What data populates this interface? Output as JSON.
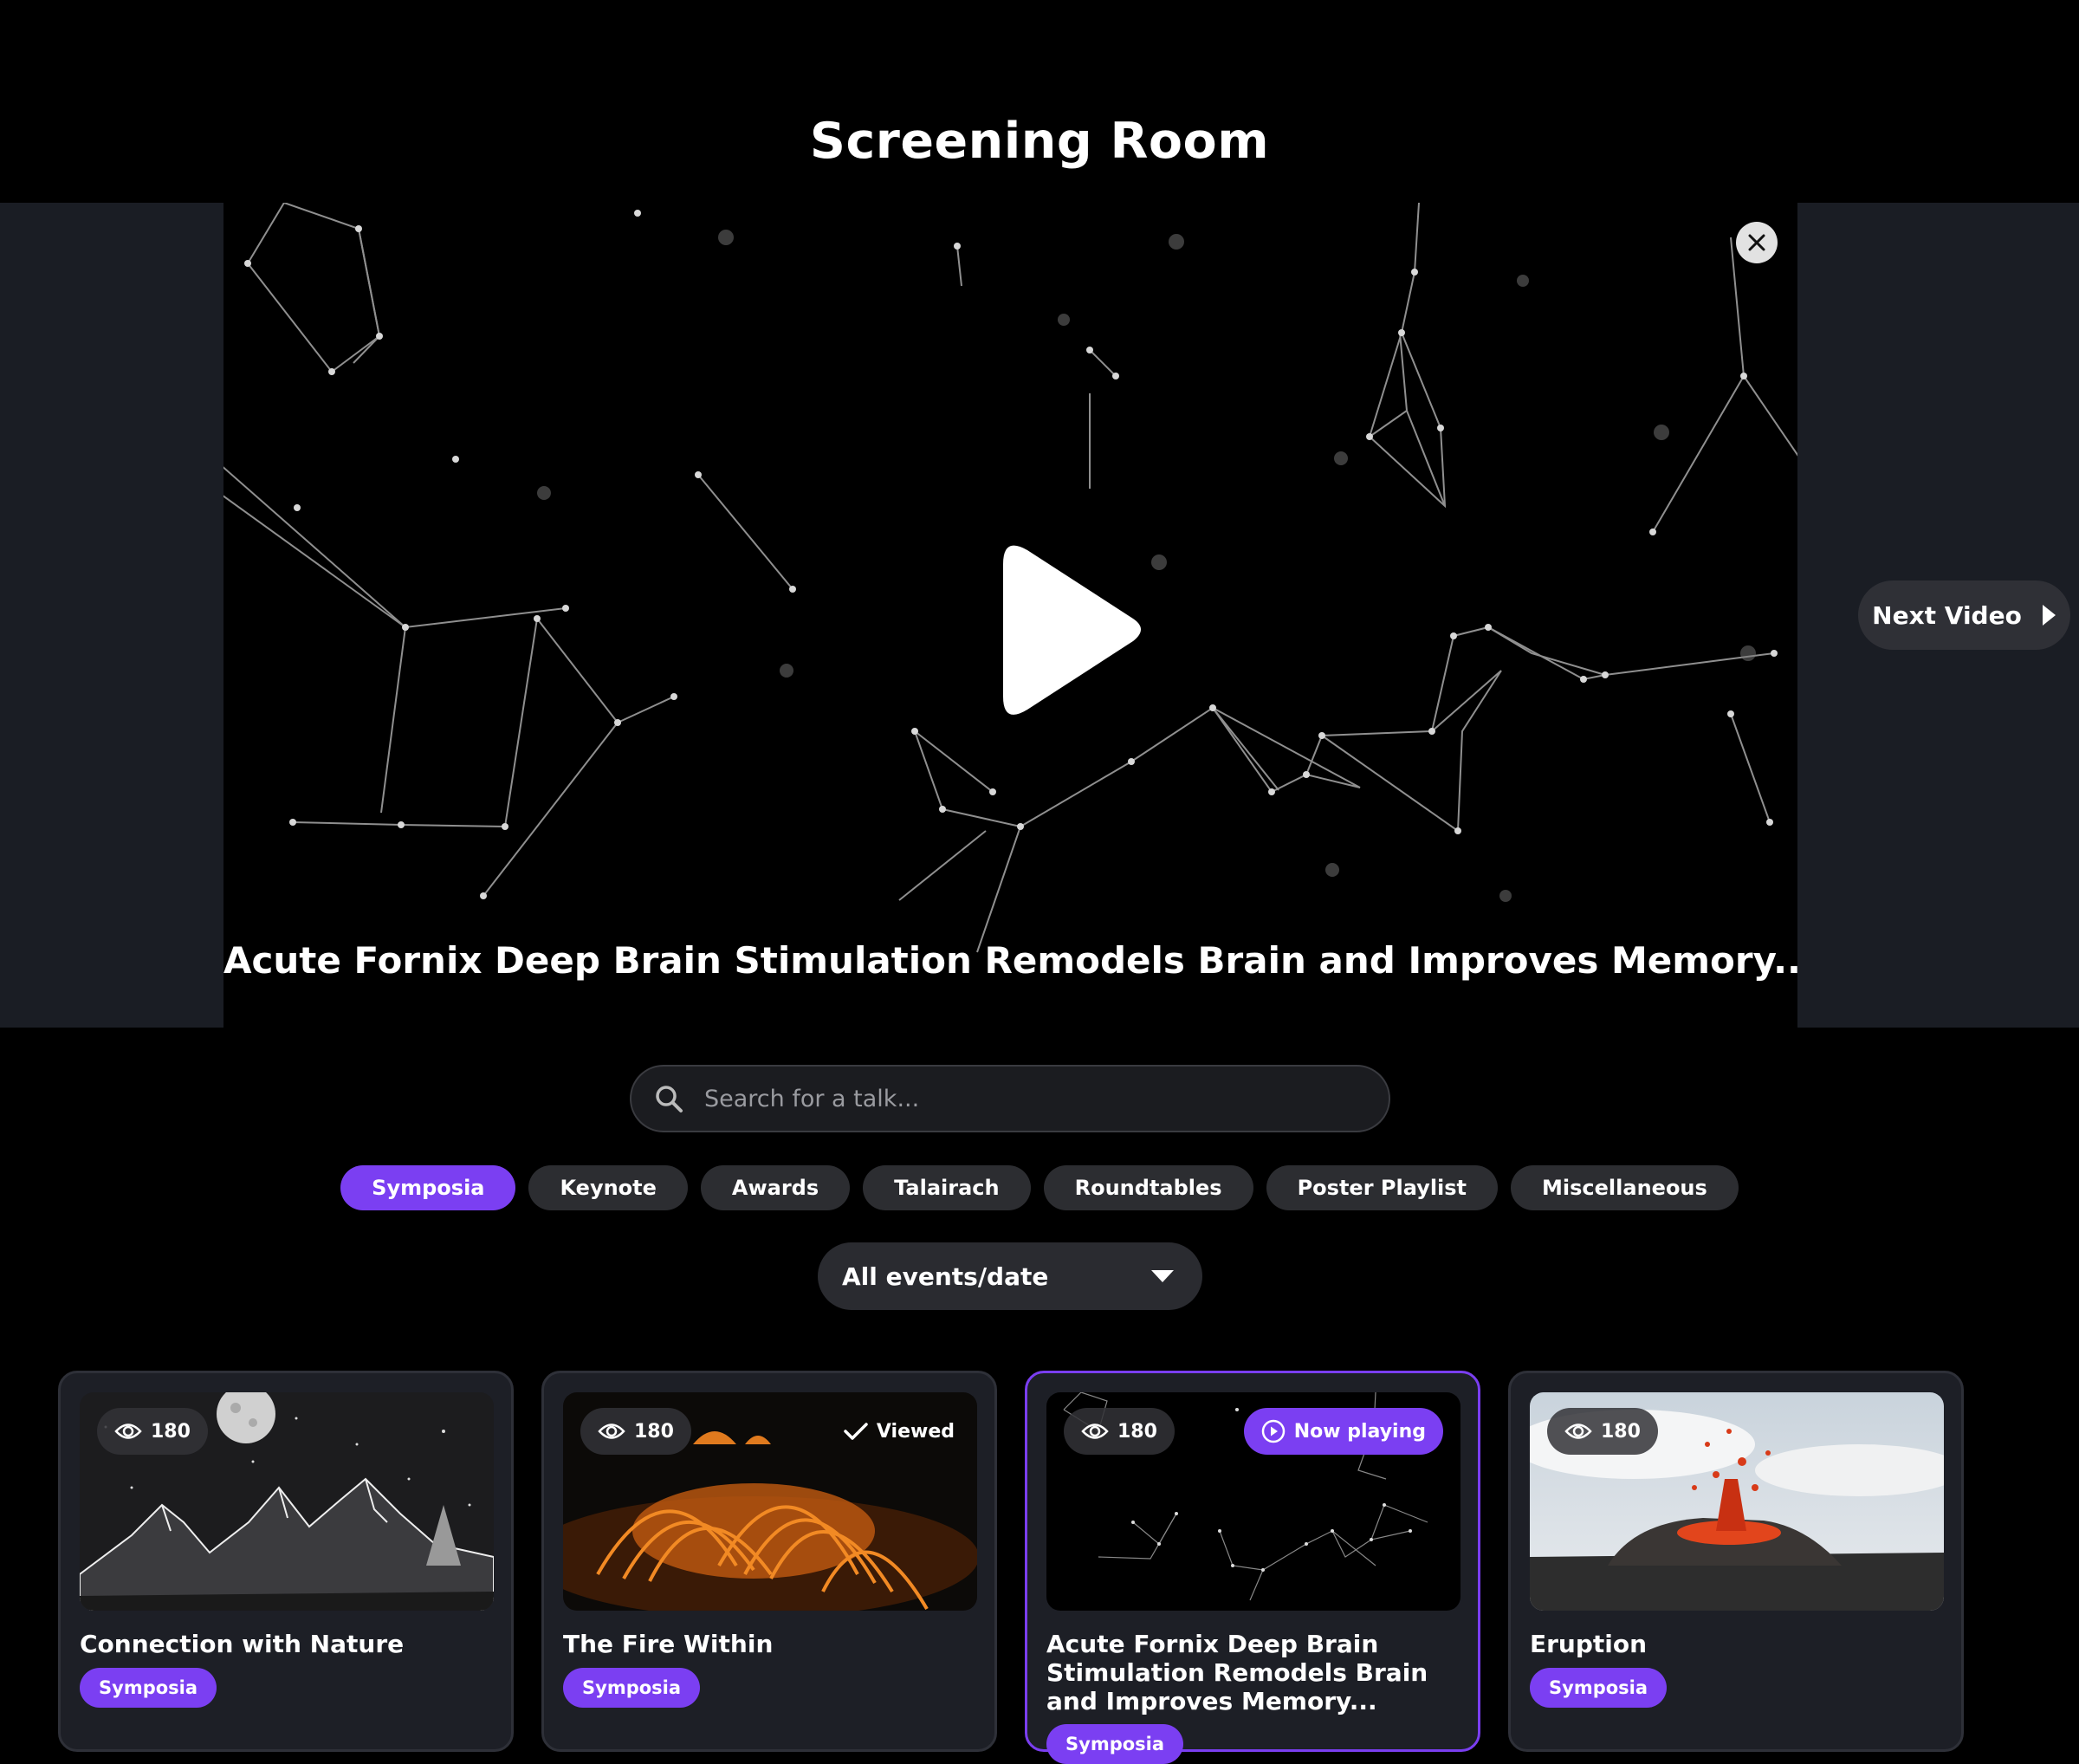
{
  "page": {
    "title": "Screening Room"
  },
  "player": {
    "video_title": "Acute Fornix Deep Brain Stimulation Remodels Brain and Improves Memory...",
    "next_label": "Next Video"
  },
  "search": {
    "placeholder": "Search for a talk..."
  },
  "tabs": [
    {
      "label": "Symposia",
      "active": true
    },
    {
      "label": "Keynote"
    },
    {
      "label": "Awards"
    },
    {
      "label": "Talairach"
    },
    {
      "label": "Roundtables"
    },
    {
      "label": "Poster Playlist"
    },
    {
      "label": "Miscellaneous"
    }
  ],
  "filter": {
    "selected": "All events/date"
  },
  "cards": [
    {
      "title": "Connection with Nature",
      "views": "180",
      "badge": "Symposia"
    },
    {
      "title": "The Fire Within",
      "views": "180",
      "badge": "Symposia",
      "status": "Viewed"
    },
    {
      "title": "Acute Fornix Deep Brain Stimulation Remodels Brain and Improves Memory...",
      "views": "180",
      "badge": "Symposia",
      "status": "Now playing"
    },
    {
      "title": "Eruption",
      "views": "180",
      "badge": "Symposia"
    }
  ],
  "colors": {
    "accent": "#7b3ff2",
    "panel": "#1a1d24",
    "chip": "#2c2d31"
  },
  "icons": [
    "close-icon",
    "play-icon",
    "triangle-right-icon",
    "search-icon",
    "chevron-down-icon",
    "eye-icon",
    "check-icon",
    "play-circle-icon"
  ]
}
